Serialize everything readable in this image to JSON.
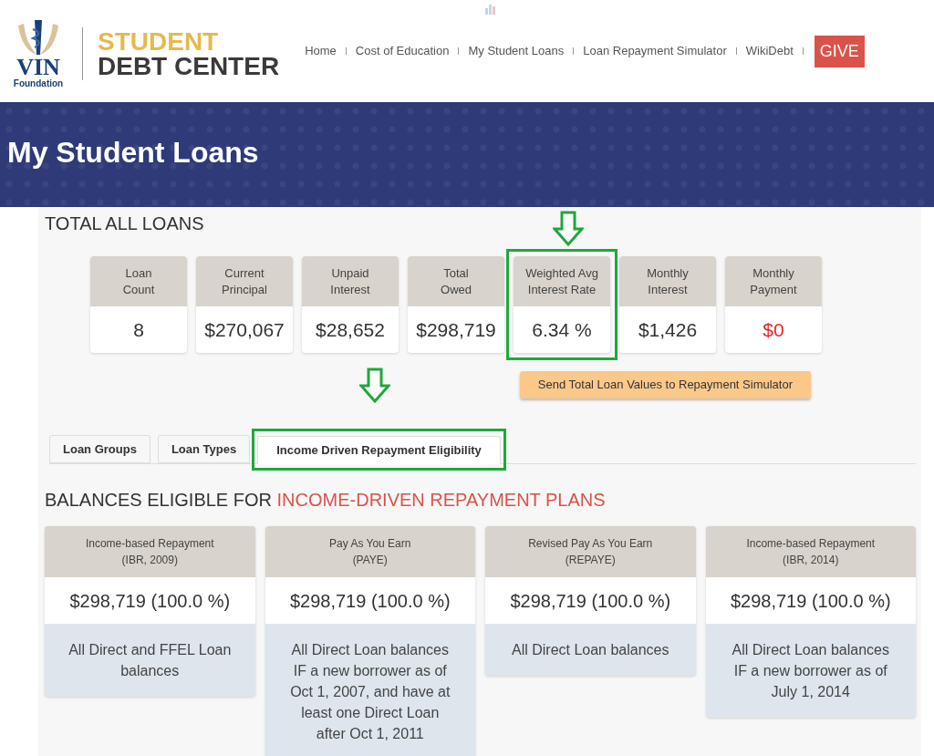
{
  "logo": {
    "mark": "VIN",
    "org": "Foundation",
    "title_top": "STUDENT",
    "title_bottom": "DEBT CENTER"
  },
  "nav": [
    {
      "label": "Home",
      "kind": "link"
    },
    {
      "label": "Cost of Education",
      "kind": "link"
    },
    {
      "label": "My Student Loans",
      "kind": "link"
    },
    {
      "label": "Loan Repayment Simulator",
      "kind": "link"
    },
    {
      "label": "WikiDebt",
      "kind": "link"
    },
    {
      "label": "GIVE",
      "kind": "button"
    }
  ],
  "banner": {
    "title": "My Student Loans"
  },
  "totals": {
    "heading": "TOTAL ALL LOANS",
    "metrics": [
      {
        "label": "Loan\nCount",
        "value": "8",
        "color": "#333333",
        "highlighted": false
      },
      {
        "label": "Current\nPrincipal",
        "value": "$270,067",
        "color": "#333333",
        "highlighted": false
      },
      {
        "label": "Unpaid\nInterest",
        "value": "$28,652",
        "color": "#333333",
        "highlighted": false
      },
      {
        "label": "Total\nOwed",
        "value": "$298,719",
        "color": "#333333",
        "highlighted": false
      },
      {
        "label": "Weighted Avg\nInterest Rate",
        "value": "6.34 %",
        "color": "#333333",
        "highlighted": true
      },
      {
        "label": "Monthly\nInterest",
        "value": "$1,426",
        "color": "#333333",
        "highlighted": false
      },
      {
        "label": "Monthly\nPayment",
        "value": "$0",
        "color": "#e8262b",
        "highlighted": false
      }
    ],
    "send_button": "Send Total Loan Values to Repayment Simulator"
  },
  "tabs": [
    {
      "label": "Loan Groups",
      "selected": false,
      "highlighted": false
    },
    {
      "label": "Loan Types",
      "selected": false,
      "highlighted": false
    },
    {
      "label": "Income Driven Repayment Eligibility",
      "selected": true,
      "highlighted": true
    }
  ],
  "eligibility": {
    "heading_lead": "BALANCES ELIGIBLE FOR",
    "heading_emphasis": "INCOME-DRIVEN REPAYMENT PLANS",
    "plans": [
      {
        "name": "Income-based Repayment\n(IBR, 2009)",
        "amount": "$298,719 (100.0 %)",
        "note": "All Direct and FFEL Loan balances"
      },
      {
        "name": "Pay As You Earn\n(PAYE)",
        "amount": "$298,719 (100.0 %)",
        "note": "All Direct Loan balances IF a new borrower as of Oct 1, 2007, and have at least one Direct Loan after Oct 1, 2011"
      },
      {
        "name": "Revised Pay As You Earn\n(REPAYE)",
        "amount": "$298,719 (100.0 %)",
        "note": "All Direct Loan balances"
      },
      {
        "name": "Income-based Repayment\n(IBR, 2014)",
        "amount": "$298,719 (100.0 %)",
        "note": "All Direct Loan balances IF a new borrower as of July 1, 2014"
      }
    ]
  }
}
